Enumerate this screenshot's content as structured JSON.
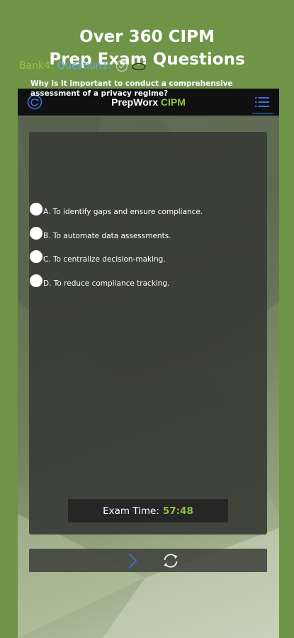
{
  "headline": {
    "line1": "Over 360 CIPM",
    "line2": "Prep Exam Questions"
  },
  "appbar": {
    "title_main": "PrepWorx",
    "title_accent": "CIPM",
    "left_icon": "refresh-circle-icon",
    "right_icon": "list-menu-icon"
  },
  "question": {
    "bank": "Bank4:",
    "number": "Question1:",
    "text": "Why is it important to conduct a comprehensive assessment of a privacy regime?",
    "options": [
      "A. To identify gaps and ensure compliance.",
      "B. To automate data assessments.",
      "C. To centralize decision-making.",
      "D. To reduce compliance tracking."
    ]
  },
  "timer": {
    "label": "Exam Time:",
    "value": "57:48"
  },
  "colors": {
    "background": "#6f9447",
    "accent_green": "#8dc63f",
    "accent_blue": "#6aa9e8",
    "appbar": "#101010"
  }
}
